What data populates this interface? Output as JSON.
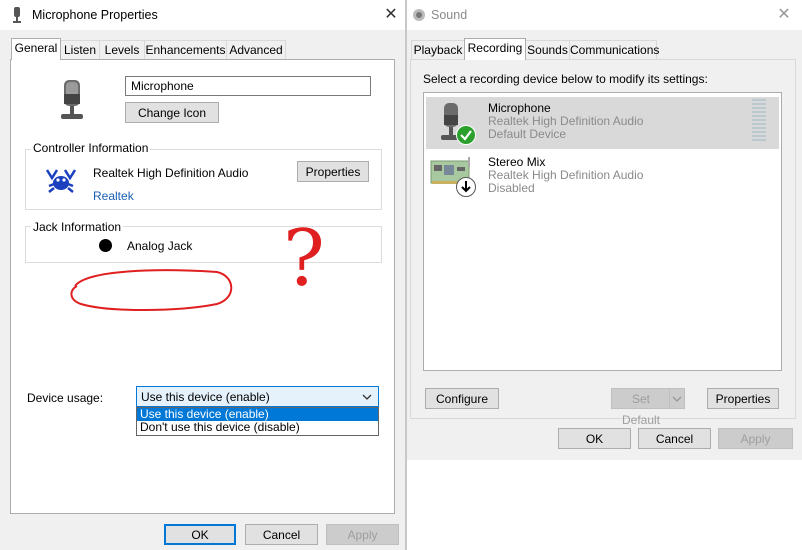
{
  "mic_props": {
    "title": "Microphone Properties",
    "tabs": [
      "General",
      "Listen",
      "Levels",
      "Enhancements",
      "Advanced"
    ],
    "device_name": "Microphone",
    "change_icon_label": "Change Icon",
    "controller": {
      "group_label": "Controller Information",
      "name": "Realtek High Definition Audio",
      "link": "Realtek",
      "properties_label": "Properties"
    },
    "jack": {
      "group_label": "Jack Information",
      "name": "Analog Jack"
    },
    "annotation_text": "?",
    "device_usage": {
      "label": "Device usage:",
      "selected": "Use this device (enable)",
      "options": [
        "Use this device (enable)",
        "Don't use this device (disable)"
      ]
    },
    "buttons": {
      "ok": "OK",
      "cancel": "Cancel",
      "apply": "Apply"
    }
  },
  "sound": {
    "title": "Sound",
    "tabs": [
      "Playback",
      "Recording",
      "Sounds",
      "Communications"
    ],
    "instruction": "Select a recording device below to modify its settings:",
    "devices": [
      {
        "name": "Microphone",
        "driver": "Realtek High Definition Audio",
        "status": "Default Device",
        "icon": "microphone-icon",
        "badge": "check-badge-icon"
      },
      {
        "name": "Stereo Mix",
        "driver": "Realtek High Definition Audio",
        "status": "Disabled",
        "icon": "sound-card-icon",
        "badge": "down-arrow-badge-icon"
      }
    ],
    "buttons": {
      "configure": "Configure",
      "set_default": "Set Default",
      "properties": "Properties",
      "ok": "OK",
      "cancel": "Cancel",
      "apply": "Apply"
    }
  },
  "colors": {
    "accent": "#0078d7",
    "selection_gray": "#d9d9d9",
    "annotation_red": "#e02020",
    "check_green": "#2ca02c"
  }
}
